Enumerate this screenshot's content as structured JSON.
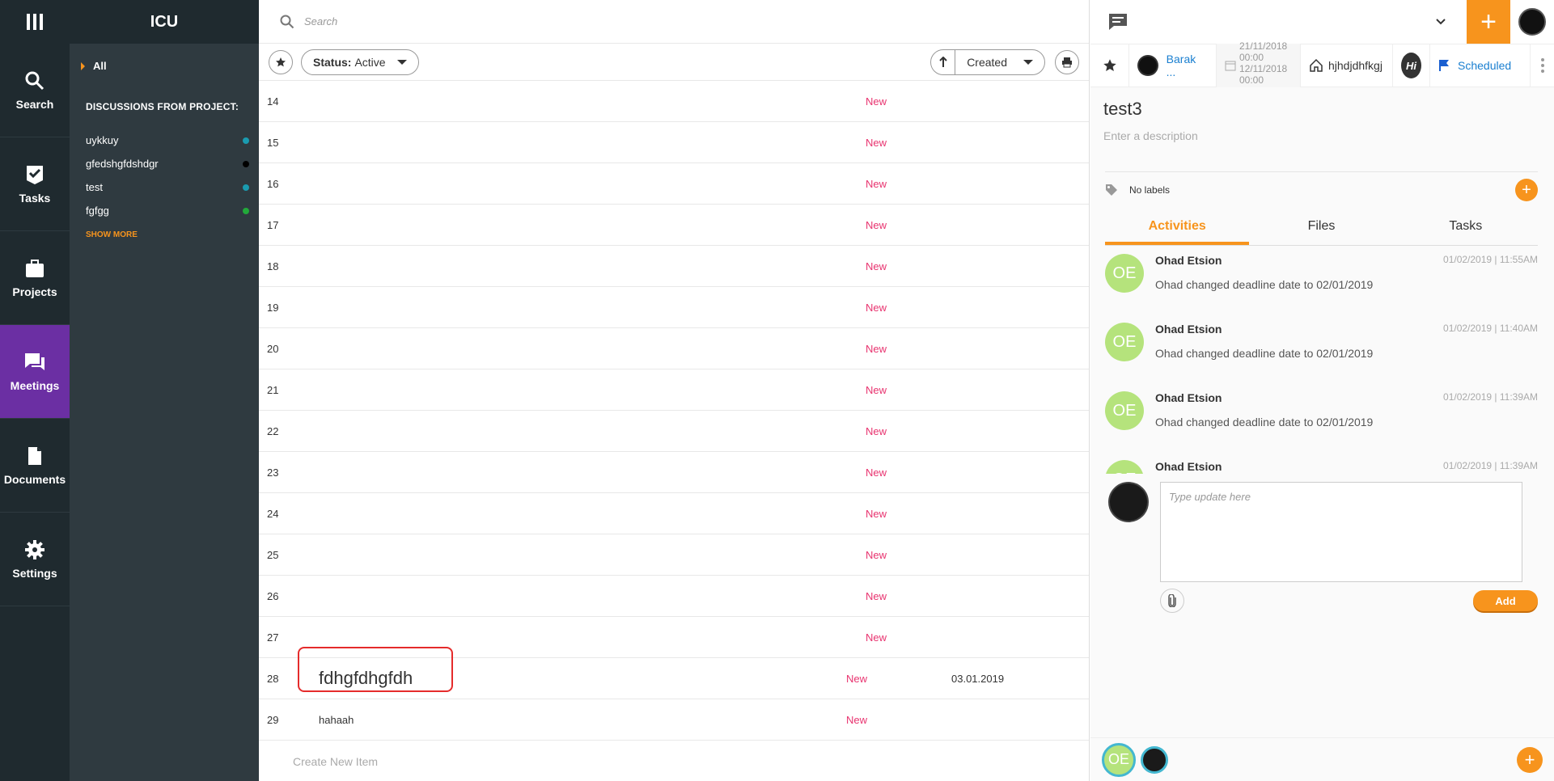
{
  "app": {
    "title": "ICU"
  },
  "nav": [
    {
      "label": "Search",
      "icon": "search-icon"
    },
    {
      "label": "Tasks",
      "icon": "check-icon"
    },
    {
      "label": "Projects",
      "icon": "briefcase-icon"
    },
    {
      "label": "Meetings",
      "icon": "chat-icon",
      "active": true
    },
    {
      "label": "Documents",
      "icon": "document-icon"
    },
    {
      "label": "Settings",
      "icon": "gear-icon"
    }
  ],
  "sidebar": {
    "all_label": "All",
    "section_title": "DISCUSSIONS FROM PROJECT:",
    "projects": [
      {
        "name": "uykkuy",
        "color": "#1a9bb0"
      },
      {
        "name": "gfedshgfdshdgr",
        "color": "#000000"
      },
      {
        "name": "test",
        "color": "#1a9bb0"
      },
      {
        "name": "fgfgg",
        "color": "#22a93a"
      }
    ],
    "show_more": "SHOW MORE"
  },
  "list": {
    "search_placeholder": "Search",
    "status_label": "Status:",
    "status_value": "Active",
    "sort_value": "Created",
    "rows": [
      {
        "num": "14",
        "title": "",
        "status": "New",
        "date": ""
      },
      {
        "num": "15",
        "title": "",
        "status": "New",
        "date": ""
      },
      {
        "num": "16",
        "title": "",
        "status": "New",
        "date": ""
      },
      {
        "num": "17",
        "title": "",
        "status": "New",
        "date": ""
      },
      {
        "num": "18",
        "title": "",
        "status": "New",
        "date": ""
      },
      {
        "num": "19",
        "title": "",
        "status": "New",
        "date": ""
      },
      {
        "num": "20",
        "title": "",
        "status": "New",
        "date": ""
      },
      {
        "num": "21",
        "title": "",
        "status": "New",
        "date": ""
      },
      {
        "num": "22",
        "title": "",
        "status": "New",
        "date": ""
      },
      {
        "num": "23",
        "title": "",
        "status": "New",
        "date": ""
      },
      {
        "num": "24",
        "title": "",
        "status": "New",
        "date": ""
      },
      {
        "num": "25",
        "title": "",
        "status": "New",
        "date": ""
      },
      {
        "num": "26",
        "title": "",
        "status": "New",
        "date": ""
      },
      {
        "num": "27",
        "title": "",
        "status": "New",
        "date": ""
      },
      {
        "num": "28",
        "title": "fdhgfdhgfdh",
        "status": "New",
        "date": "03.01.2019",
        "highlight": true
      },
      {
        "num": "29",
        "title": "hahaah",
        "status": "New",
        "date": ""
      }
    ],
    "create_new": "Create New Item"
  },
  "detail": {
    "assignee": "Barak ...",
    "dates": [
      "21/11/2018",
      "00:00",
      "12/11/2018",
      "00:00"
    ],
    "project": "hjhdjdhfkgj",
    "status": "Scheduled",
    "title": "test3",
    "description_placeholder": "Enter a description",
    "labels_text": "No labels",
    "tabs": [
      "Activities",
      "Files",
      "Tasks"
    ],
    "activities": [
      {
        "initials": "OE",
        "name": "Ohad Etsion",
        "time": "01/02/2019 | 11:55AM",
        "text": "Ohad changed deadline date to 02/01/2019"
      },
      {
        "initials": "OE",
        "name": "Ohad Etsion",
        "time": "01/02/2019 | 11:40AM",
        "text": "Ohad changed deadline date to 02/01/2019"
      },
      {
        "initials": "OE",
        "name": "Ohad Etsion",
        "time": "01/02/2019 | 11:39AM",
        "text": "Ohad changed deadline date to 02/01/2019"
      },
      {
        "initials": "OE",
        "name": "Ohad Etsion",
        "time": "01/02/2019 | 11:39AM",
        "text": ""
      }
    ],
    "update_placeholder": "Type update here",
    "add_label": "Add",
    "footer_initials": "OE"
  },
  "colors": {
    "accent": "#f7941d",
    "nav_active": "#6b2fa3",
    "status_new": "#e8336f",
    "link": "#1a7fd0"
  }
}
